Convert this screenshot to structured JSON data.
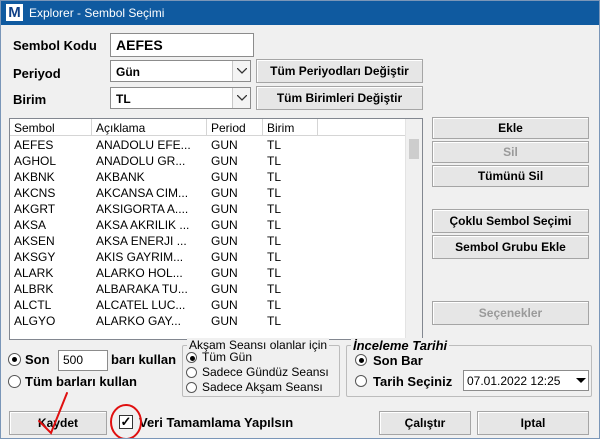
{
  "window": {
    "title": "Explorer - Sembol Seçimi",
    "logo": "M"
  },
  "form": {
    "symbol_code_label": "Sembol Kodu",
    "symbol_code_value": "AEFES",
    "period_label": "Periyod",
    "period_value": "Gün",
    "change_all_periods": "Tüm Periyodları Değiştir",
    "unit_label": "Birim",
    "unit_value": "TL",
    "change_all_units": "Tüm Birimleri Değiştir"
  },
  "grid": {
    "columns": [
      "Sembol",
      "Açıklama",
      "Period",
      "Birim"
    ],
    "rows": [
      [
        "AEFES",
        "ANADOLU EFE...",
        "GUN",
        "TL"
      ],
      [
        "AGHOL",
        "ANADOLU GR...",
        "GUN",
        "TL"
      ],
      [
        "AKBNK",
        "AKBANK",
        "GUN",
        "TL"
      ],
      [
        "AKCNS",
        "AKCANSA CIM...",
        "GUN",
        "TL"
      ],
      [
        "AKGRT",
        "AKSIGORTA A....",
        "GUN",
        "TL"
      ],
      [
        "AKSA",
        "AKSA AKRILIK ...",
        "GUN",
        "TL"
      ],
      [
        "AKSEN",
        "AKSA ENERJI ...",
        "GUN",
        "TL"
      ],
      [
        "AKSGY",
        "AKIS GAYRIM...",
        "GUN",
        "TL"
      ],
      [
        "ALARK",
        "ALARKO HOL...",
        "GUN",
        "TL"
      ],
      [
        "ALBRK",
        "ALBARAKA TU...",
        "GUN",
        "TL"
      ],
      [
        "ALCTL",
        "ALCATEL LUC...",
        "GUN",
        "TL"
      ],
      [
        "ALGYO",
        "ALARKO GAY...",
        "GUN",
        "TL"
      ]
    ]
  },
  "side_buttons": {
    "add": "Ekle",
    "delete": "Sil",
    "delete_all": "Tümünü Sil",
    "multi_select": "Çoklu Sembol Seçimi",
    "add_group": "Sembol Grubu Ekle",
    "options": "Seçenekler"
  },
  "bars": {
    "son_label": "Son",
    "son_value": "500",
    "use_bars_label": "barı kullan",
    "use_all_label": "Tüm barları kullan"
  },
  "evening": {
    "title": "Akşam Seansı olanlar için",
    "opt_all": "Tüm Gün",
    "opt_day": "Sadece Gündüz Seansı",
    "opt_evening": "Sadece Akşam Seansı"
  },
  "review": {
    "title": "İnceleme Tarihi",
    "opt_last": "Son Bar",
    "opt_date": "Tarih Seçiniz",
    "date_value": "07.01.2022 12:25"
  },
  "footer": {
    "save": "Kaydet",
    "data_completion": "Veri Tamamlama Yapılsın",
    "run": "Çalıştır",
    "cancel": "Iptal"
  }
}
